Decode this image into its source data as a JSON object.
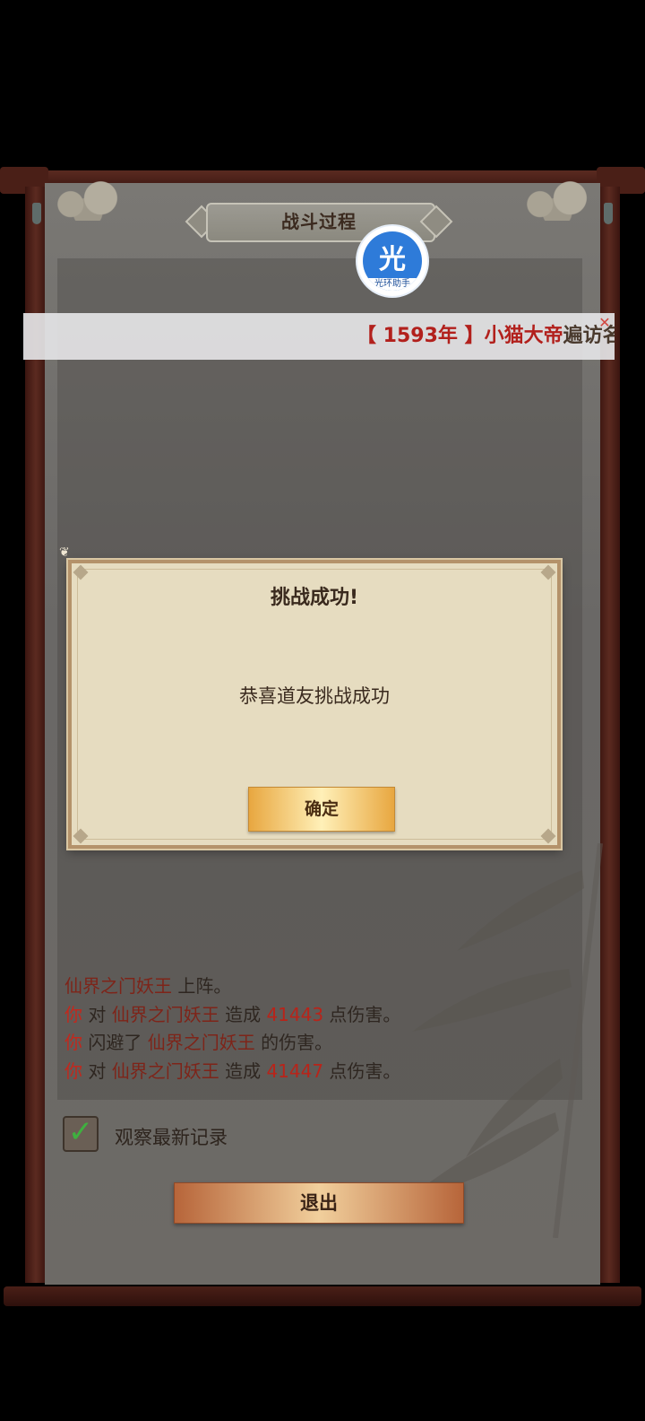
{
  "panel": {
    "title": "战斗过程"
  },
  "overlay_badge": {
    "char": "光",
    "label": "光环助手"
  },
  "ticker": {
    "year": "【 1593年 】",
    "name": "小猫大帝",
    "action": "遍访名",
    "close": "✕"
  },
  "dialog": {
    "title": "挑战成功!",
    "message": "恭喜道友挑战成功",
    "confirm_label": "确定"
  },
  "battle_log": [
    {
      "subject": "仙界之门妖王",
      "text": " 上阵。"
    },
    {
      "subject": "你",
      "mid1": " 对 ",
      "target": "仙界之门妖王",
      "mid2": " 造成 ",
      "value": "41443",
      "end": " 点伤害。"
    },
    {
      "subject": "你",
      "mid1": " 闪避了 ",
      "target": "仙界之门妖王",
      "end": " 的伤害。"
    },
    {
      "subject": "你",
      "mid1": " 对 ",
      "target": "仙界之门妖王",
      "mid2": " 造成 ",
      "value": "41447",
      "end": " 点伤害。"
    }
  ],
  "watch_latest": {
    "label": "观察最新记录",
    "checked": true,
    "tick": "✓"
  },
  "exit_button": {
    "label": "退出"
  },
  "colors": {
    "accent_red": "#c2281d",
    "dialog_bg": "#e6dcc0",
    "confirm_gold": "#e8a740"
  }
}
